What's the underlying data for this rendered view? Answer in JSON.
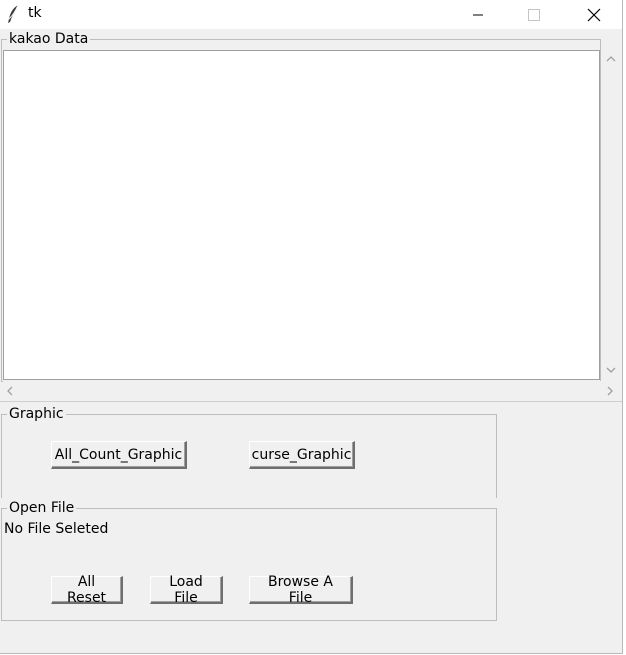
{
  "window": {
    "title": "tk"
  },
  "kakao": {
    "label": "kakao Data"
  },
  "graphic": {
    "label": "Graphic",
    "buttons": {
      "all_count": "All_Count_Graphic",
      "curse": "curse_Graphic"
    }
  },
  "open_file": {
    "label": "Open File",
    "status": "No File Seleted",
    "buttons": {
      "reset": "All Reset",
      "load": "Load File",
      "browse": "Browse A File"
    }
  }
}
